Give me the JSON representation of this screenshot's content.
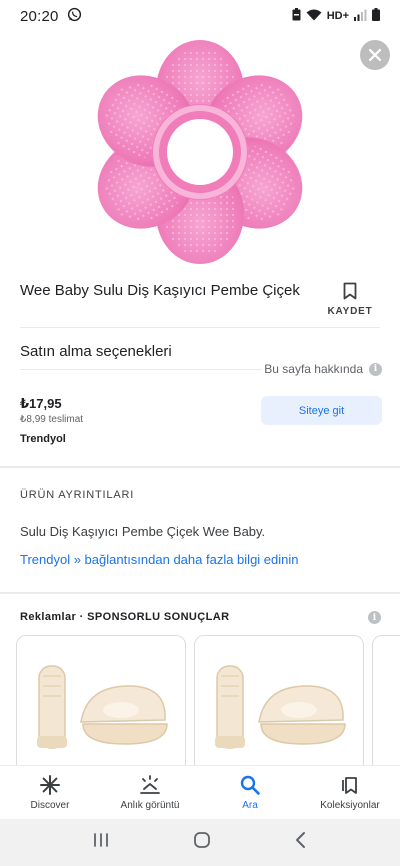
{
  "status_bar": {
    "time": "20:20",
    "network": "HD+"
  },
  "product": {
    "title": "Wee Baby Sulu Diş Kaşıyıcı Pembe Çiçek",
    "image_icon": "pink-flower-teether"
  },
  "save": {
    "label": "KAYDET"
  },
  "purchase": {
    "section_title": "Satın alma seçenekleri",
    "about_label": "Bu sayfa hakkında",
    "price": "₺17,95",
    "shipping": "₺8,99 teslimat",
    "seller": "Trendyol",
    "visit_label": "Siteye git"
  },
  "details": {
    "heading": "ÜRÜN AYRINTILARI",
    "description": "Sulu Diş Kaşıyıcı Pembe Çiçek Wee Baby.",
    "link": "Trendyol » bağlantısından daha fazla bilgi edinin"
  },
  "ads": {
    "heading": "Reklamlar · SPONSORLU SONUÇLAR"
  },
  "bottom_nav": {
    "items": [
      {
        "label": "Discover",
        "icon": "asterisk-icon"
      },
      {
        "label": "Anlık görüntü",
        "icon": "snapshot-icon"
      },
      {
        "label": "Ara",
        "icon": "search-icon"
      },
      {
        "label": "Koleksiyonlar",
        "icon": "collections-icon"
      }
    ]
  },
  "colors": {
    "accent": "#1a73e8",
    "accent_light": "#e8f0fe",
    "flower_pink": "#ef7ab8",
    "close_button": "#bdbdbd"
  }
}
